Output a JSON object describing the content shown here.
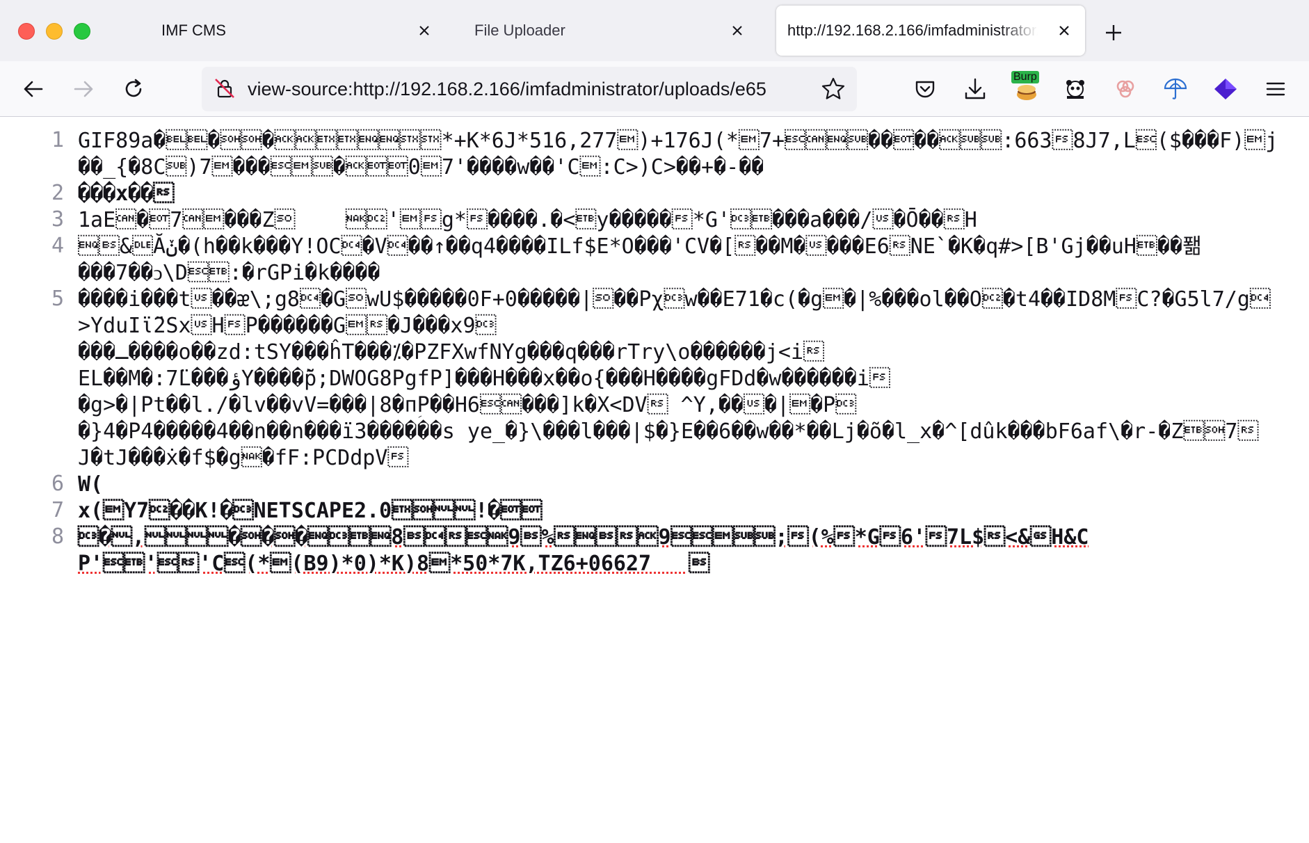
{
  "tabs": [
    {
      "label": "IMF CMS",
      "active": false
    },
    {
      "label": "File Uploader",
      "active": false
    },
    {
      "label": "http://192.168.2.166/imfadministrator/uploads/e65",
      "active": true
    }
  ],
  "toolbar": {
    "url": "view-source:http://192.168.2.166/imfadministrator/uploads/e65",
    "burp_badge": "Burp",
    "icons": [
      "back-icon",
      "forward-icon",
      "reload-icon",
      "insecure-lock-icon",
      "bookmark-star-icon",
      "pocket-icon",
      "downloads-icon",
      "burp-extension-icon",
      "panda-extension-icon",
      "extension-icon",
      "vpn-extension-icon",
      "wappalyzer-icon",
      "menu-icon"
    ]
  },
  "colors": {
    "tab_bar": "#f0f0f4",
    "nav_bar": "#f9f9fb",
    "accent_purple": "#881280",
    "line_numbers": "#8f8f9d"
  },
  "source": {
    "lines": [
      {
        "num": "1",
        "text": "GIF89a�\u0007\u0007�\u0001\u0001�\u0006\u0006\u0003\u0003\u0005\u0005\u0002\u0002*+K*6J*516,277\u0019)+176J(*\u00197+\u001b\u0018\u0005\u001a��\u0004��\u0006\u001a\u001a:663\u001c8J7,L\u001b($���F)\u0019j��_{�8C\u001a)7\u0019���\u001b\u0019\u001a�\u0006\u0004\u00040\u00197'����w��'C\u0019:C>)C>��+�-��"
      },
      {
        "num": "2",
        "text": "���x��\u001e"
      },
      {
        "num": "3",
        "text": "1aE\u0018�\u00047\u0018\u0019���Z\u000e    \u0015\u0012'\u0019\u001cg*\u001c����.�<\u0017y�����\u001c*G'\u0013\u0017���a���/\u001f�Ō��\u001eH"
      },
      {
        "num": "4",
        "text": "\u0005\b&\u0010Ăݩ�(h��k���Y!OC\u0014�V\u0014��↑��q4����ILf$E*O���'CV�[\u001e��M�\u001f���E6\u001eNE`�K�q#>[B'\rGj��uH\u0017��퐮\n���7��ↄ\\D\u001b\u0017:�rGPi�k����"
      },
      {
        "num": "5",
        "text": "����i���t\u001f��ᴂ\\;g8\u0014�G\u000ewU$�����0F+0�����|\u000e��Pχ\u0013w��E71�c(�g\u0019�|%���ol��O\u0012�t4��ID8M\u001cC?�G5l7/g\u0014  >YduIϊ̈2Sx\u001fH\u001cP������G\u0019\u001e�J���x9\u0013\n���ـ����o��zd:tSY���ĥT���⁒�PZFXwfNYg���q���rTry\\o������j<i\u001e\nEL��M�:7̈L���ؤY����̆̃p;DWOG8PgfP]���H���x��o{���H����gFDd�w������i\u001c\n�g>�|Pt��l./�lv��vV=���|8�пؚP��H6\u001b\u0018���]k�X<DV\u001e ^Y,��\u001f�|\u0019�P\u0013\n�}4�P4�����4��n��n���ï3������s ye_�}\\���l���|$�}E��6��w��*��Lj�õ�l_x�^[dûk���bF6af\\�r-�Z\u0017\u00017\u001e\nJ�tJ���ẋ�f$�g\u0015�fF:PCDdpV\u001c"
      },
      {
        "num": "6",
        "text": "W("
      },
      {
        "num": "7",
        "text": "x(\u0019Y7\u0012��K!�\u0013NETSCAPE2.0\u0003\u0001\u0000\u0000!�\u0004\u0004"
      },
      {
        "num": "8",
        "text": "\u0013�\u0000,\u0000\u0000\u0000\u0000�\u0001�\u0001�\u0005\u0013\u0017\u00058\b\u0014\u001e\u001b\u00159\b%\u001e\u0005\b\u001e\u00069\u001b\u001b\u0019\u001a\u001a;\u001c(%\u001c*G\u001c6'\u001c7L$\u001e<&\u001dH&CP'\u001b\u0017'\u001b\u001e'C\u001b(*\u0019(B9)*0)*K)8\u0019*50*7K,TZ6+06627   \b"
      }
    ]
  }
}
